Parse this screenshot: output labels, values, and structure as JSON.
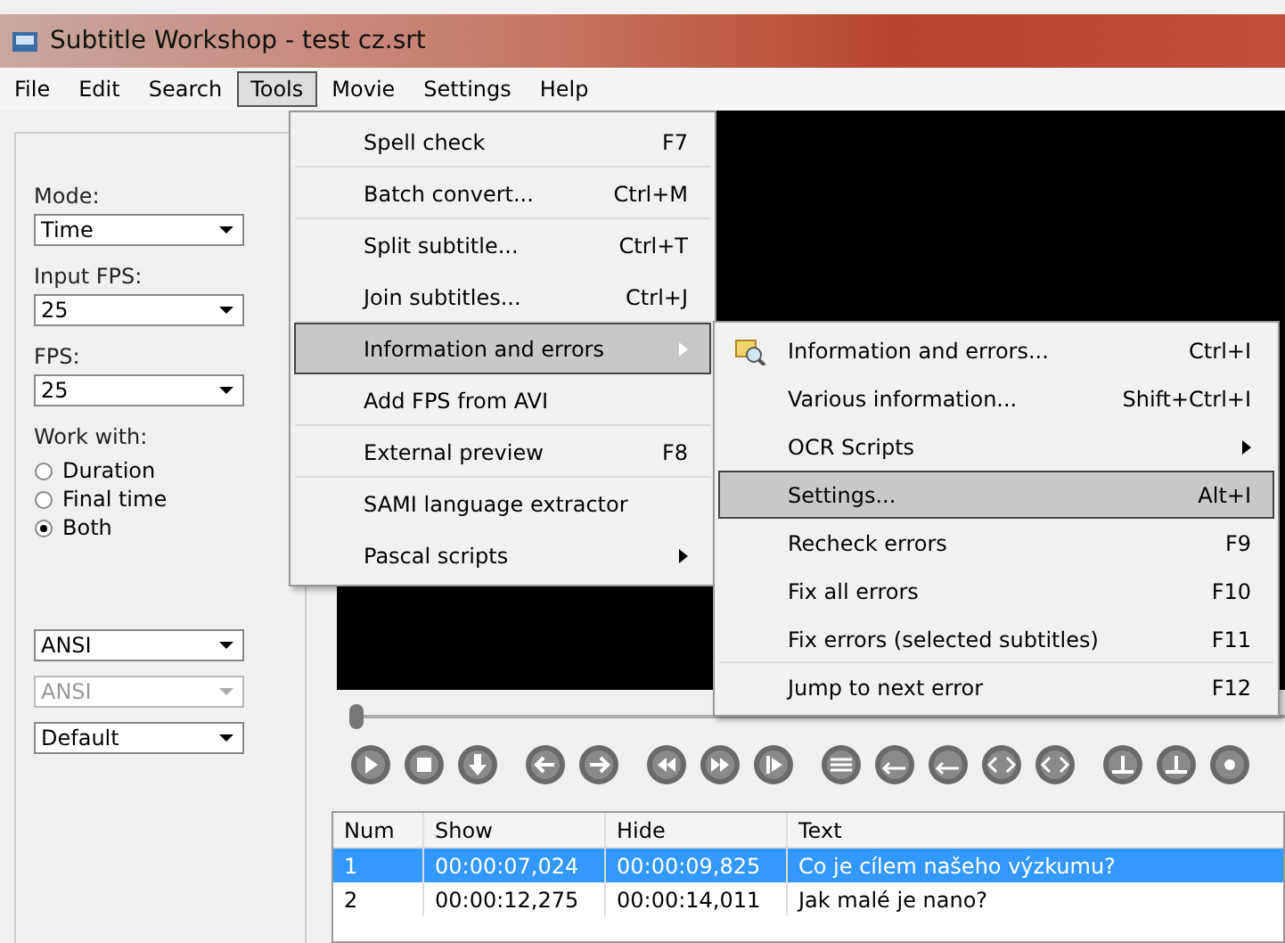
{
  "window": {
    "title": "Subtitle Workshop - test cz.srt"
  },
  "menu_bar": [
    {
      "label": "File",
      "selected": false
    },
    {
      "label": "Edit",
      "selected": false
    },
    {
      "label": "Search",
      "selected": false
    },
    {
      "label": "Tools",
      "selected": true
    },
    {
      "label": "Movie",
      "selected": false
    },
    {
      "label": "Settings",
      "selected": false
    },
    {
      "label": "Help",
      "selected": false
    }
  ],
  "tools_menu": [
    {
      "label": "Spell check",
      "shortcut": "F7",
      "selected": false,
      "submenu": false,
      "separator_after": true
    },
    {
      "label": "Batch convert...",
      "shortcut": "Ctrl+M",
      "selected": false,
      "submenu": false,
      "separator_after": true
    },
    {
      "label": "Split subtitle...",
      "shortcut": "Ctrl+T",
      "selected": false,
      "submenu": false,
      "separator_after": false
    },
    {
      "label": "Join subtitles...",
      "shortcut": "Ctrl+J",
      "selected": false,
      "submenu": false,
      "separator_after": true
    },
    {
      "label": "Information and errors",
      "selected": true,
      "submenu": true,
      "separator_after": false
    },
    {
      "label": "Add FPS from AVI",
      "selected": false,
      "submenu": false,
      "separator_after": true
    },
    {
      "label": "External preview",
      "shortcut": "F8",
      "selected": false,
      "submenu": false,
      "separator_after": true
    },
    {
      "label": "SAMI language extractor",
      "selected": false,
      "submenu": false,
      "separator_after": false
    },
    {
      "label": "Pascal scripts",
      "selected": false,
      "submenu": true,
      "separator_after": false
    }
  ],
  "info_submenu": [
    {
      "label": "Information and errors...",
      "shortcut": "Ctrl+I",
      "selected": false,
      "submenu": false,
      "has_icon": true,
      "separator_after": false
    },
    {
      "label": "Various information...",
      "shortcut": "Shift+Ctrl+I",
      "selected": false,
      "submenu": false,
      "has_icon": false,
      "separator_after": false
    },
    {
      "label": "OCR Scripts",
      "selected": false,
      "submenu": true,
      "has_icon": false,
      "separator_after": false
    },
    {
      "label": "Settings...",
      "shortcut": "Alt+I",
      "selected": true,
      "submenu": false,
      "has_icon": false,
      "separator_after": false
    },
    {
      "label": "Recheck errors",
      "shortcut": "F9",
      "selected": false,
      "submenu": false,
      "has_icon": false,
      "separator_after": false
    },
    {
      "label": "Fix all errors",
      "shortcut": "F10",
      "selected": false,
      "submenu": false,
      "has_icon": false,
      "separator_after": false
    },
    {
      "label": "Fix errors (selected subtitles)",
      "shortcut": "F11",
      "selected": false,
      "submenu": false,
      "has_icon": false,
      "separator_after": true
    },
    {
      "label": "Jump to next error",
      "shortcut": "F12",
      "selected": false,
      "submenu": false,
      "has_icon": false,
      "separator_after": false
    }
  ],
  "left_panel": {
    "fields": [
      {
        "label": "Mode:",
        "value": "Time",
        "disabled": false
      },
      {
        "label": "Input FPS:",
        "value": "25",
        "disabled": false
      },
      {
        "label": "FPS:",
        "value": "25",
        "disabled": false
      }
    ],
    "work_with": {
      "label": "Work with:",
      "options": [
        {
          "label": "Duration",
          "selected": false
        },
        {
          "label": "Final time",
          "selected": false
        },
        {
          "label": "Both",
          "selected": true
        }
      ]
    },
    "dropdowns": [
      {
        "value": "ANSI",
        "disabled": false
      },
      {
        "value": "ANSI",
        "disabled": true
      },
      {
        "value": "Default",
        "disabled": false
      }
    ]
  },
  "seek_slider": {
    "level": 0
  },
  "table": {
    "columns": [
      "Num",
      "Show",
      "Hide",
      "Text"
    ],
    "rows": [
      {
        "cells": [
          "1",
          "00:00:07,024",
          "00:00:09,825",
          "Co je cílem našeho výzkumu?"
        ],
        "selected": true
      },
      {
        "cells": [
          "2",
          "00:00:12,275",
          "00:00:14,011",
          "Jak malé je nano?"
        ],
        "selected": false
      }
    ]
  }
}
